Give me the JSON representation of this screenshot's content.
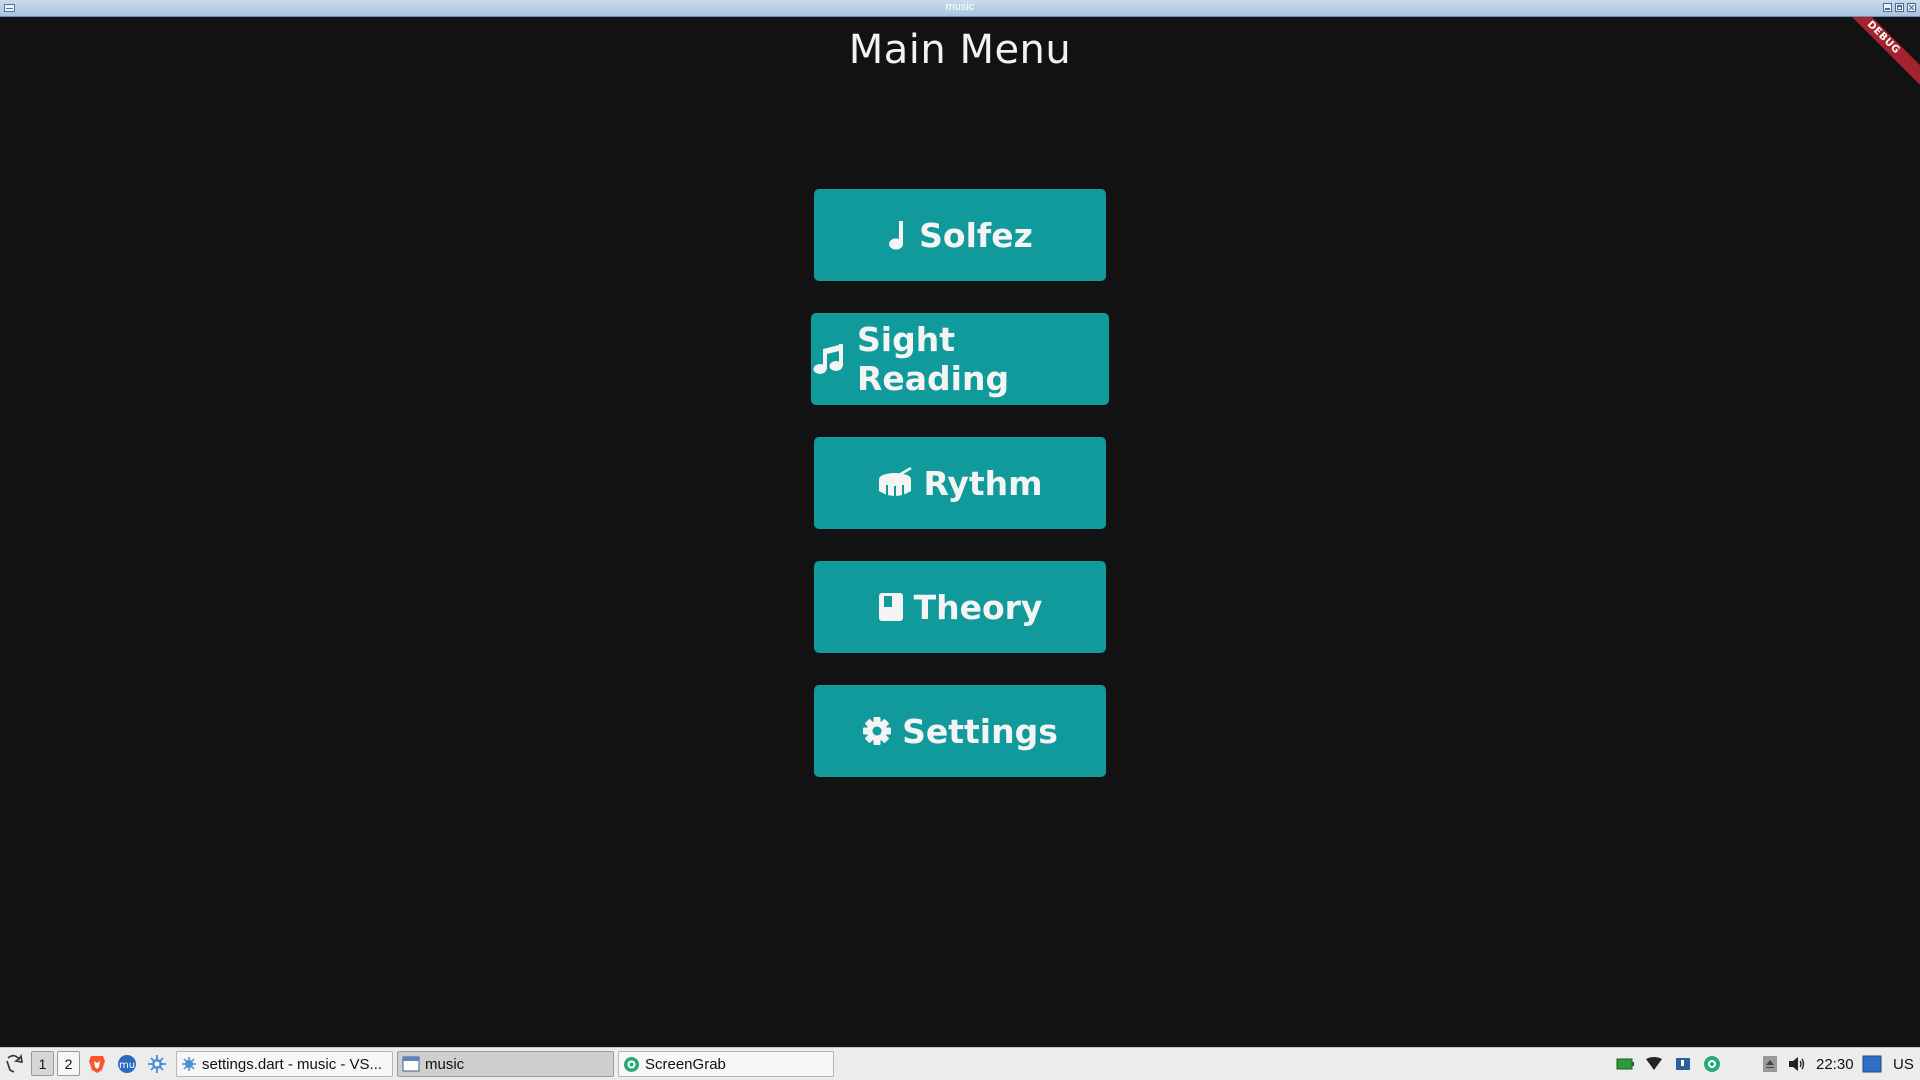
{
  "window": {
    "title": "music"
  },
  "app": {
    "page_title": "Main Menu",
    "debug_banner": "DEBUG",
    "menu_items": [
      {
        "label": "Solfez",
        "icon": "music-note-icon"
      },
      {
        "label": "Sight Reading",
        "icon": "music-notes-icon"
      },
      {
        "label": "Rythm",
        "icon": "drum-icon"
      },
      {
        "label": "Theory",
        "icon": "book-icon"
      },
      {
        "label": "Settings",
        "icon": "gear-icon"
      }
    ]
  },
  "taskbar": {
    "workspaces": [
      "1",
      "2"
    ],
    "tasks": [
      {
        "label": "settings.dart - music - VS..."
      },
      {
        "label": "music"
      },
      {
        "label": "ScreenGrab"
      }
    ],
    "clock": "22:30",
    "keyboard_layout": "US"
  },
  "colors": {
    "background": "#121212",
    "button": "#119a9c",
    "button_text": "#f4f4f4",
    "debug_banner": "#a4232f"
  }
}
